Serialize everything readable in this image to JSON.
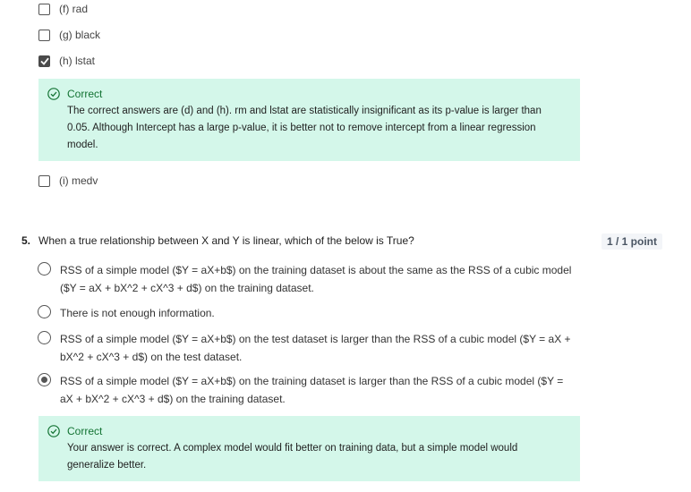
{
  "options": [
    {
      "label": "(f) rad",
      "checked": false
    },
    {
      "label": "(g) black",
      "checked": false
    },
    {
      "label": "(h) lstat",
      "checked": true
    },
    {
      "label": "(i) medv",
      "checked": false
    }
  ],
  "feedback1": {
    "title": "Correct",
    "text": "The correct answers are (d) and (h). rm and lstat are statistically insignificant as its p-value is larger than 0.05. Although Intercept has a large p-value, it is better not to remove intercept from a linear regression model."
  },
  "question5": {
    "number": "5.",
    "text": "When a true relationship between X and Y is linear, which of the below is True?",
    "points": "1 / 1 point",
    "choices": [
      {
        "label": "RSS of a simple model ($Y = aX+b$) on the training dataset is about the same as the RSS of a cubic model ($Y = aX + bX^2 + cX^3 + d$) on the training dataset.",
        "selected": false
      },
      {
        "label": "There is not enough information.",
        "selected": false
      },
      {
        "label": "RSS of a simple model ($Y = aX+b$) on the test dataset is larger than the RSS of a cubic model ($Y = aX + bX^2 + cX^3 + d$) on the test dataset.",
        "selected": false
      },
      {
        "label": "RSS of a simple model ($Y = aX+b$) on the training dataset is larger than the RSS of a cubic model ($Y = aX + bX^2 + cX^3 + d$) on the training dataset.",
        "selected": true
      }
    ]
  },
  "feedback2": {
    "title": "Correct",
    "text": "Your answer is correct. A complex model would fit better on training data, but a simple model would generalize better."
  },
  "colors": {
    "feedback_bg": "#d4f7ea",
    "correct_green": "#137333"
  }
}
